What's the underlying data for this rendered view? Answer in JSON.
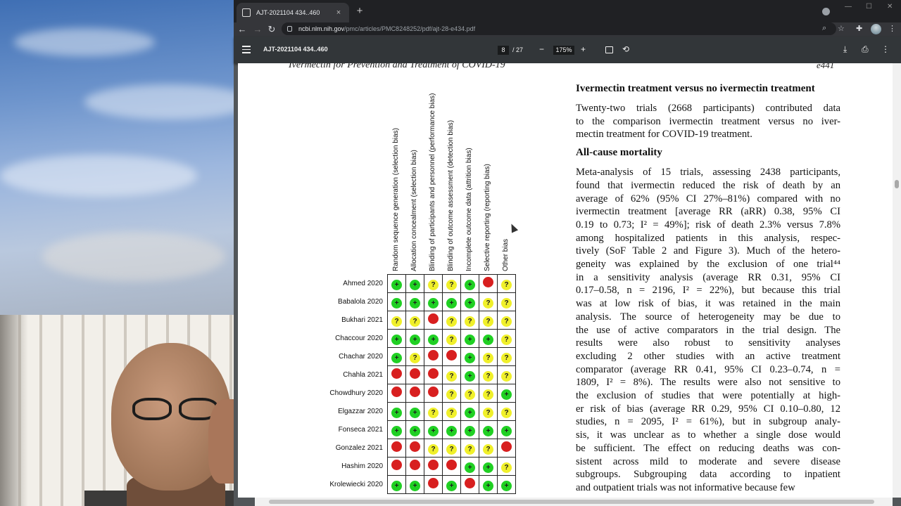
{
  "browser": {
    "tab_title": "AJT-2021104 434..460",
    "tab_close": "×",
    "new_tab": "+",
    "url_host": "ncbi.nlm.nih.gov",
    "url_path": "/pmc/articles/PMC8248252/pdf/ajt-28-e434.pdf"
  },
  "pdf_toolbar": {
    "title": "AJT-2021104 434..460",
    "page_current": "8",
    "page_total": "/ 27",
    "zoom_out": "−",
    "zoom_level": "175%",
    "zoom_in": "+"
  },
  "document": {
    "running_head": "Ivermectin for Prevention and Treatment of COVID-19",
    "page_number": "e441",
    "bias_columns": [
      "Random sequence generation (selection bias)",
      "Allocation concealment (selection bias)",
      "Blinding of participants and personnel (performance bias)",
      "Blinding of outcome assessment (detection bias)",
      "Incomplete outcome data (attrition bias)",
      "Selective reporting (reporting bias)",
      "Other bias"
    ],
    "studies": [
      {
        "name": "Ahmed 2020",
        "ratings": [
          "low",
          "low",
          "unclear",
          "unclear",
          "low",
          "high",
          "unclear"
        ]
      },
      {
        "name": "Babalola 2020",
        "ratings": [
          "low",
          "low",
          "low",
          "low",
          "low",
          "unclear",
          "unclear"
        ]
      },
      {
        "name": "Bukhari 2021",
        "ratings": [
          "unclear",
          "unclear",
          "high",
          "unclear",
          "unclear",
          "unclear",
          "unclear"
        ]
      },
      {
        "name": "Chaccour 2020",
        "ratings": [
          "low",
          "low",
          "low",
          "unclear",
          "low",
          "low",
          "unclear"
        ]
      },
      {
        "name": "Chachar 2020",
        "ratings": [
          "low",
          "unclear",
          "high",
          "high",
          "low",
          "unclear",
          "unclear"
        ]
      },
      {
        "name": "Chahla 2021",
        "ratings": [
          "high",
          "high",
          "high",
          "unclear",
          "low",
          "unclear",
          "unclear"
        ]
      },
      {
        "name": "Chowdhury 2020",
        "ratings": [
          "high",
          "high",
          "high",
          "unclear",
          "unclear",
          "unclear",
          "low"
        ]
      },
      {
        "name": "Elgazzar 2020",
        "ratings": [
          "low",
          "low",
          "unclear",
          "unclear",
          "low",
          "unclear",
          "unclear"
        ]
      },
      {
        "name": "Fonseca 2021",
        "ratings": [
          "low",
          "low",
          "low",
          "low",
          "low",
          "low",
          "low"
        ]
      },
      {
        "name": "Gonzalez 2021",
        "ratings": [
          "high",
          "high",
          "unclear",
          "unclear",
          "unclear",
          "unclear",
          "high"
        ]
      },
      {
        "name": "Hashim 2020",
        "ratings": [
          "high",
          "high",
          "high",
          "high",
          "low",
          "low",
          "unclear"
        ]
      },
      {
        "name": "Krolewiecki 2020",
        "ratings": [
          "low",
          "low",
          "high",
          "low",
          "high",
          "low",
          "low"
        ]
      }
    ],
    "symbols": {
      "low": "+",
      "unclear": "?",
      "high": ""
    },
    "heading_1": "Ivermectin treatment versus no ivermectin treatment",
    "para_1": [
      "Twenty-two trials (2668 participants) contributed data",
      "to the comparison ivermectin treatment versus no iver-",
      "mectin treatment for COVID-19 treatment."
    ],
    "heading_2": "All-cause mortality",
    "para_2": [
      "Meta-analysis of 15 trials, assessing 2438 participants,",
      "found that ivermectin reduced the risk of death by an",
      "average of 62% (95% CI 27%–81%) compared with no",
      "ivermectin treatment [average RR (aRR) 0.38, 95% CI",
      "0.19 to 0.73; I² = 49%]; risk of death 2.3% versus 7.8%",
      "among hospitalized patients in this analysis, respec-",
      "tively (SoF Table 2 and Figure 3). Much of the hetero-",
      "geneity was explained by the exclusion of one trial⁴⁴",
      "in a sensitivity analysis (average RR 0.31, 95% CI",
      "0.17–0.58, n = 2196, I² = 22%), but because this trial",
      "was at low risk of bias, it was retained in the main",
      "analysis. The source of heterogeneity may be due to",
      "the use of active comparators in the trial design. The",
      "results were also robust to sensitivity analyses",
      "excluding 2 other studies with an active treatment",
      "comparator (average RR 0.41, 95% CI 0.23–0.74, n =",
      "1809, I² = 8%). The results were also not sensitive to",
      "the exclusion of studies that were potentially at high-",
      "er risk of bias (average RR 0.29, 95% CI 0.10–0.80, 12",
      "studies, n = 2095, I² = 61%), but in subgroup analy-",
      "sis, it was unclear as to whether a single dose would",
      "be sufficient. The effect on reducing deaths was con-",
      "sistent across mild to moderate and severe disease",
      "subgroups. Subgrouping data according to inpatient",
      "and outpatient trials was not informative because few"
    ]
  },
  "colors": {
    "low": "#20d023",
    "unclear": "#f0f02a",
    "high": "#d81f1f"
  }
}
